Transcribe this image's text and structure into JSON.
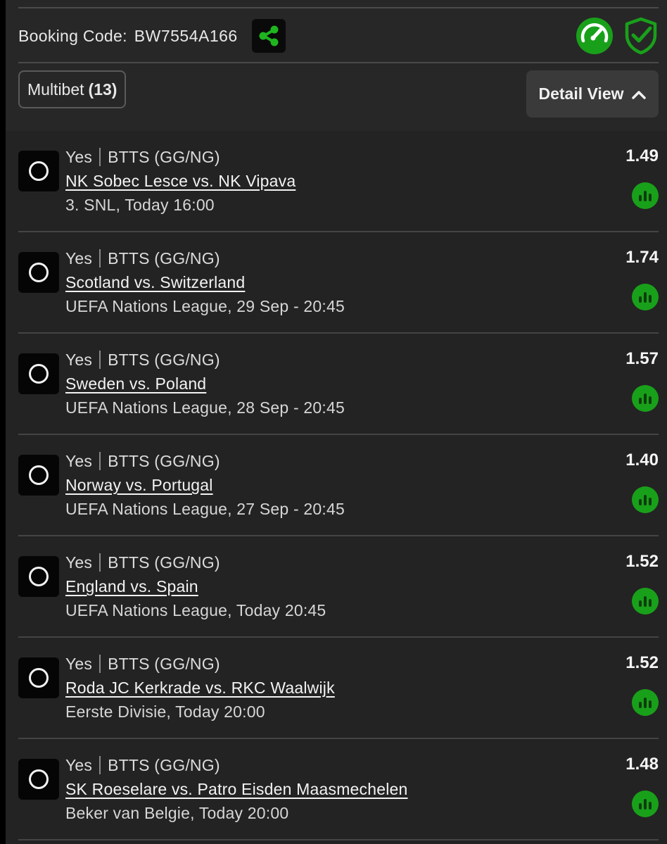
{
  "header": {
    "booking_label": "Booking Code:",
    "booking_code": "BW7554A166",
    "share_icon": "share-icon",
    "speedometer_icon": "speedometer-icon",
    "shield_check_icon": "shield-check-icon",
    "accent_color": "#19a01a"
  },
  "bet_type": {
    "label": "Multibet",
    "count": "(13)"
  },
  "view_toggle": {
    "label": "Detail View",
    "icon": "chevron-up-icon"
  },
  "bets": [
    {
      "selection": "Yes",
      "market": "BTTS (GG/NG)",
      "match": "NK Sobec Lesce vs. NK Vipava",
      "info": "3. SNL, Today 16:00",
      "odds": "1.49"
    },
    {
      "selection": "Yes",
      "market": "BTTS (GG/NG)",
      "match": "Scotland vs. Switzerland",
      "info": "UEFA Nations League, 29 Sep - 20:45",
      "odds": "1.74"
    },
    {
      "selection": "Yes",
      "market": "BTTS (GG/NG)",
      "match": "Sweden vs. Poland",
      "info": "UEFA Nations League, 28 Sep - 20:45",
      "odds": "1.57"
    },
    {
      "selection": "Yes",
      "market": "BTTS (GG/NG)",
      "match": "Norway vs. Portugal",
      "info": "UEFA Nations League, 27 Sep - 20:45",
      "odds": "1.40"
    },
    {
      "selection": "Yes",
      "market": "BTTS (GG/NG)",
      "match": "England vs. Spain",
      "info": "UEFA Nations League, Today 20:45",
      "odds": "1.52"
    },
    {
      "selection": "Yes",
      "market": "BTTS (GG/NG)",
      "match": "Roda JC Kerkrade vs. RKC Waalwijk",
      "info": "Eerste Divisie, Today 20:00",
      "odds": "1.52"
    },
    {
      "selection": "Yes",
      "market": "BTTS (GG/NG)",
      "match": "SK Roeselare vs. Patro Eisden Maasmechelen",
      "info": "Beker van Belgie, Today 20:00",
      "odds": "1.48"
    }
  ]
}
